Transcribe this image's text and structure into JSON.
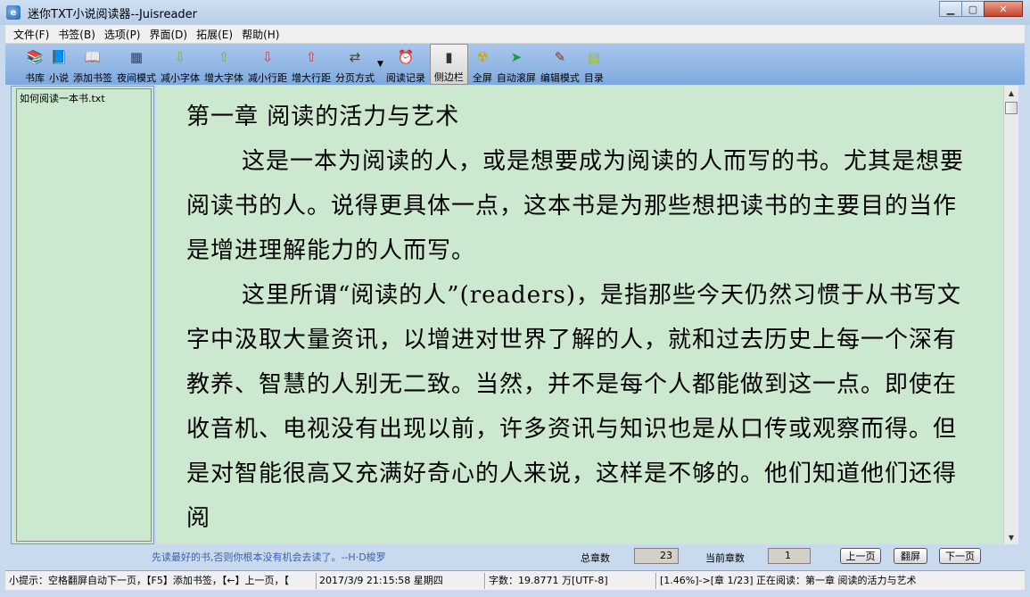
{
  "window": {
    "title": "迷你TXT小说阅读器--Juisreader",
    "app_icon_glyph": "e"
  },
  "menu": [
    "文件(F)",
    "书签(B)",
    "选项(P)",
    "界面(D)",
    "拓展(E)",
    "帮助(H)"
  ],
  "toolbar": [
    {
      "label": "书库",
      "icon": "bookshelf-icon",
      "glyph": "📚",
      "color": "#d1407a"
    },
    {
      "label": "小说",
      "icon": "book-icon",
      "glyph": "📘",
      "color": "#2b4fa8"
    },
    {
      "label": "添加书签",
      "icon": "bookmark-add-icon",
      "glyph": "📖",
      "color": "#333"
    },
    {
      "label": "夜间模式",
      "icon": "night-mode-icon",
      "glyph": "▦",
      "color": "#2b3f6e"
    },
    {
      "label": "减小字体",
      "icon": "font-decrease-icon",
      "glyph": "⇩",
      "color": "#7fb03a"
    },
    {
      "label": "增大字体",
      "icon": "font-increase-icon",
      "glyph": "⇧",
      "color": "#7fb03a"
    },
    {
      "label": "减小行距",
      "icon": "line-spacing-decrease-icon",
      "glyph": "⇩",
      "color": "#d93a3a"
    },
    {
      "label": "增大行距",
      "icon": "line-spacing-increase-icon",
      "glyph": "⇧",
      "color": "#d93a3a"
    },
    {
      "label": "分页方式",
      "icon": "pagination-icon",
      "glyph": "⇄",
      "color": "#444"
    },
    {
      "label": "阅读记录",
      "icon": "clock-icon",
      "glyph": "⏰",
      "color": "#222"
    },
    {
      "label": "侧边栏",
      "icon": "sidebar-icon",
      "glyph": "▮",
      "color": "#333",
      "active": true
    },
    {
      "label": "全屏",
      "icon": "fullscreen-icon",
      "glyph": "☢",
      "color": "#d8a100"
    },
    {
      "label": "自动滚屏",
      "icon": "auto-scroll-icon",
      "glyph": "➤",
      "color": "#1d9a3a"
    },
    {
      "label": "编辑模式",
      "icon": "edit-icon",
      "glyph": "✎",
      "color": "#7a3b1d"
    },
    {
      "label": "目录",
      "icon": "contents-icon",
      "glyph": "▤",
      "color": "#9ab84a"
    }
  ],
  "sidebar": {
    "files": [
      "如何阅读一本书.txt"
    ]
  },
  "reader": {
    "chapter_title": "第一章 阅读的活力与艺术",
    "paragraphs": [
      "这是一本为阅读的人，或是想要成为阅读的人而写的书。尤其是想要阅读书的人。说得更具体一点，这本书是为那些想把读书的主要目的当作是增进理解能力的人而写。",
      "这里所谓“阅读的人”(readers)，是指那些今天仍然习惯于从书写文字中汲取大量资讯，以增进对世界了解的人，就和过去历史上每一个深有教养、智慧的人别无二致。当然，并不是每个人都能做到这一点。即使在收音机、电视没有出现以前，许多资讯与知识也是从口传或观察而得。但是对智能很高又充满好奇心的人来说，这样是不够的。他们知道他们还得阅"
    ]
  },
  "infobar": {
    "quote": "先读最好的书,否则你根本没有机会去读了。--H·D梭罗",
    "total_chapters_label": "总章数",
    "total_chapters": "23",
    "current_chapter_label": "当前章数",
    "current_chapter": "1",
    "prev_page": "上一页",
    "flip_page": "翻屏",
    "next_page": "下一页"
  },
  "statusbar": {
    "hint": "小提示：空格翻屏自动下一页，【F5】添加书签，【←】上一页，【",
    "datetime": "2017/3/9    21:15:58    星期四",
    "word_count": "字数：19.8771 万[UTF-8]",
    "progress": "[1.46%]->[章 1/23] 正在阅读：第一章 阅读的活力与艺术"
  }
}
